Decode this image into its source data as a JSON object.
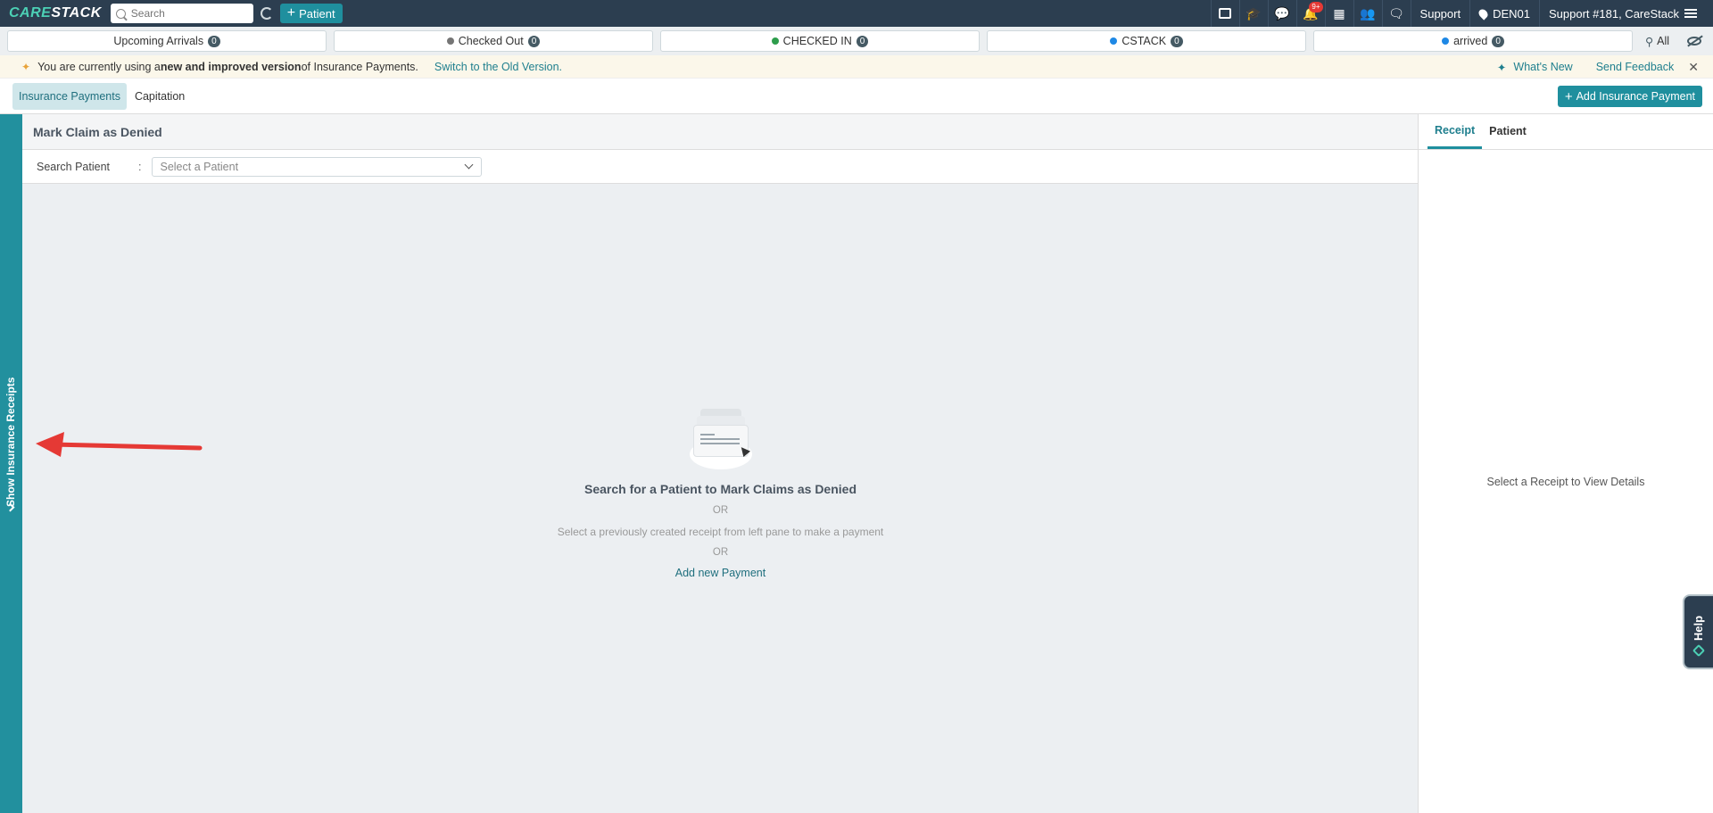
{
  "topbar": {
    "logo_care": "CARE",
    "logo_stack": "STACK",
    "search_placeholder": "Search",
    "patient_button": "Patient",
    "notification_badge": "9+",
    "support_link": "Support",
    "location": "DEN01",
    "user": "Support #181, CareStack"
  },
  "statusbar": {
    "items": [
      {
        "label": "Upcoming Arrivals",
        "count": "0",
        "dot": ""
      },
      {
        "label": "Checked Out",
        "count": "0",
        "dot": "#757575"
      },
      {
        "label": "CHECKED IN",
        "count": "0",
        "dot": "#2e9d4c"
      },
      {
        "label": "CSTACK",
        "count": "0",
        "dot": "#1e88e5"
      },
      {
        "label": "arrived",
        "count": "0",
        "dot": "#1e88e5"
      }
    ],
    "all_label": "All"
  },
  "notice": {
    "text_prefix": "You are currently using a ",
    "text_bold": "new and improved version",
    "text_suffix": " of Insurance Payments.",
    "switch_link": "Switch to the Old Version.",
    "whats_new": "What's New",
    "send_feedback": "Send Feedback"
  },
  "tabs": {
    "items": [
      "Insurance Payments",
      "Capitation"
    ],
    "add_button": "Add Insurance Payment"
  },
  "sidebar": {
    "label": "Show Insurance Receipts"
  },
  "main": {
    "header": "Mark Claim as Denied",
    "search_label": "Search Patient",
    "search_colon": ":",
    "select_placeholder": "Select a Patient",
    "empty_title": "Search for a Patient to Mark Claims as Denied",
    "or_text": "OR",
    "empty_sub": "Select a previously created receipt from left pane to make a payment",
    "add_link": "Add new Payment"
  },
  "right_panel": {
    "tabs": [
      "Receipt",
      "Patient"
    ],
    "empty_text": "Select a Receipt to View Details"
  },
  "help": {
    "label": "Help"
  },
  "colors": {
    "topbar": "#2c3e50",
    "accent": "#1f8f9e",
    "sidebar": "#22909e",
    "arrow": "#e53935"
  }
}
